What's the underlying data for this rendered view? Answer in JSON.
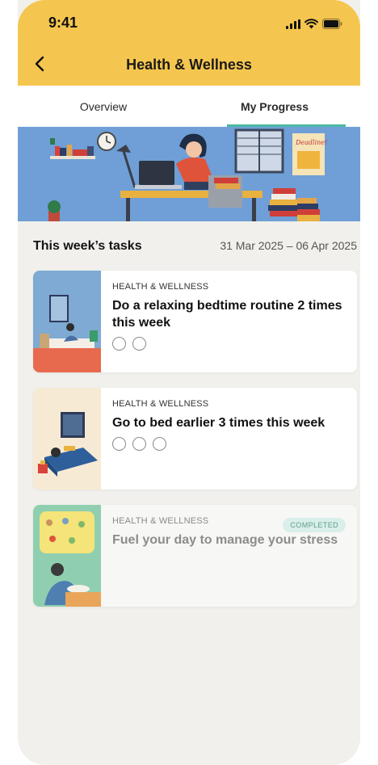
{
  "status_bar": {
    "time": "9:41",
    "icons": [
      "signal-icon",
      "wifi-icon",
      "battery-icon"
    ]
  },
  "nav": {
    "back_icon": "chevron-left-icon",
    "title": "Health & Wellness"
  },
  "tabs": [
    {
      "label": "Overview",
      "active": false
    },
    {
      "label": "My Progress",
      "active": true
    }
  ],
  "hero": {
    "sticky_note": "Deadline!"
  },
  "section": {
    "title": "This week’s tasks",
    "dates": "31 Mar 2025 – 06 Apr 2025"
  },
  "tasks": [
    {
      "category": "HEALTH & WELLNESS",
      "title": "Do a relaxing bedtime routine 2 times this week",
      "progress_total": 2,
      "progress_done": 0,
      "completed": false
    },
    {
      "category": "HEALTH & WELLNESS",
      "title": "Go to bed earlier 3 times this week",
      "progress_total": 3,
      "progress_done": 0,
      "completed": false
    },
    {
      "category": "HEALTH & WELLNESS",
      "title": "Fuel your day to manage your stress",
      "completed": true,
      "badge": "COMPLETED"
    }
  ],
  "colors": {
    "header": "#f5c64f",
    "accent": "#4bb9a3",
    "background": "#f1f0ec"
  }
}
